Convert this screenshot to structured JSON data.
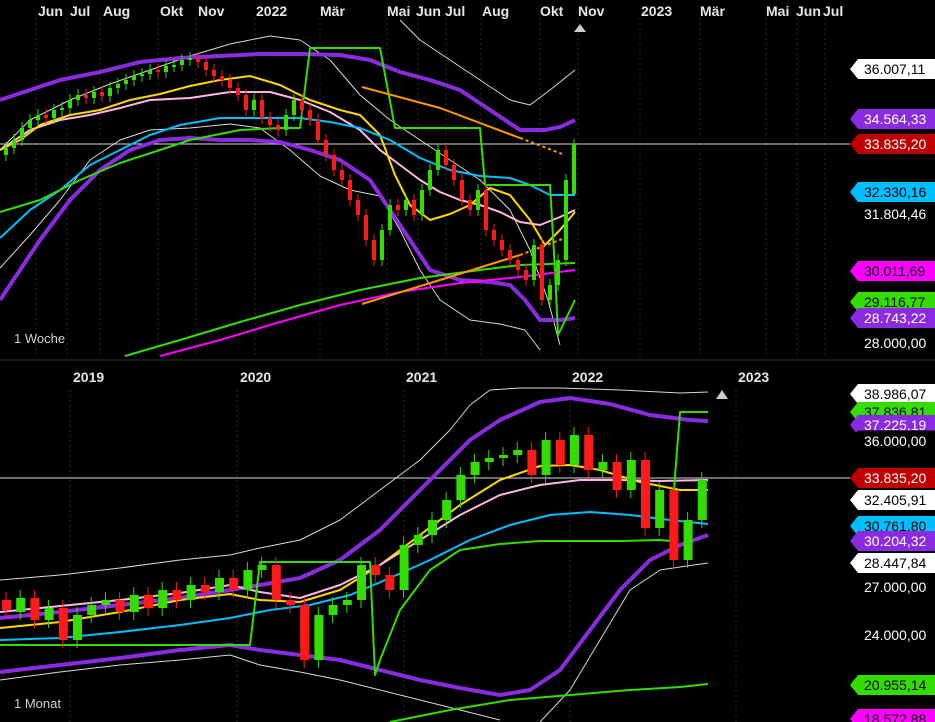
{
  "top_panel": {
    "period_label": "1 Woche",
    "time_labels": [
      "Jun",
      "Jul",
      "Aug",
      "Okt",
      "Nov",
      "2022",
      "Mär",
      "Mai",
      "Jun",
      "Jul",
      "Aug",
      "Okt",
      "Nov",
      "2023",
      "Mär",
      "Mai",
      "Jun",
      "Jul"
    ],
    "price_tags": [
      {
        "text": "36.007,11",
        "bg": "#ffffff",
        "fg": "#000000"
      },
      {
        "text": "34.564,33",
        "bg": "#8a2be2",
        "fg": "#ffffff"
      },
      {
        "text": "33.835,20",
        "bg": "#c00000",
        "fg": "#ffffff"
      },
      {
        "text": "32.330,16",
        "bg": "#00bfff",
        "fg": "#000000"
      },
      {
        "text": "31.804,46",
        "bg": "#000000",
        "fg": "#ffffff"
      },
      {
        "text": "30.011,69",
        "bg": "#ff00ff",
        "fg": "#000000"
      },
      {
        "text": "29.116,77",
        "bg": "#33dd00",
        "fg": "#000000"
      },
      {
        "text": "28.743,22",
        "bg": "#8a2be2",
        "fg": "#ffffff"
      },
      {
        "text": "28.000,00",
        "bg": "#000000",
        "fg": "#ffffff"
      }
    ]
  },
  "bottom_panel": {
    "period_label": "1 Monat",
    "time_labels": [
      "2019",
      "2020",
      "2021",
      "2022",
      "2023"
    ],
    "price_tags": [
      {
        "text": "38.986,07",
        "bg": "#ffffff",
        "fg": "#000000"
      },
      {
        "text": "37.836,81",
        "bg": "#33dd00",
        "fg": "#000000"
      },
      {
        "text": "37.225,19",
        "bg": "#8a2be2",
        "fg": "#ffffff"
      },
      {
        "text": "36.000,00",
        "bg": "#000000",
        "fg": "#ffffff"
      },
      {
        "text": "33.835,20",
        "bg": "#c00000",
        "fg": "#ffffff"
      },
      {
        "text": "32.405,91",
        "bg": "#ffffff",
        "fg": "#000000"
      },
      {
        "text": "30.761,80",
        "bg": "#00bfff",
        "fg": "#000000"
      },
      {
        "text": "30.204,32",
        "bg": "#8a2be2",
        "fg": "#ffffff"
      },
      {
        "text": "28.447,84",
        "bg": "#ffffff",
        "fg": "#000000"
      },
      {
        "text": "27.000,00",
        "bg": "#000000",
        "fg": "#ffffff"
      },
      {
        "text": "24.000,00",
        "bg": "#000000",
        "fg": "#ffffff"
      },
      {
        "text": "20.955,14",
        "bg": "#33dd00",
        "fg": "#000000"
      },
      {
        "text": "18.572,88",
        "bg": "#ff00ff",
        "fg": "#000000"
      }
    ]
  },
  "colors": {
    "up_candle": "#33dd00",
    "down_candle": "#ff1a1a",
    "bollinger": "#ffffff",
    "keltner": "#8a2be2",
    "ma_fast": "#ffd700",
    "ma_mid": "#ffb6e6",
    "ma_slow": "#00bfff",
    "ma_long": "#33dd00",
    "ma_longest": "#ff00ff",
    "trend": "#ff9900",
    "current": "#ffffff"
  },
  "chart_data": [
    {
      "type": "candlestick",
      "title": "",
      "timeframe": "1 Woche",
      "x_ticks": [
        "Jun",
        "Jul",
        "Aug",
        "Okt",
        "Nov",
        "2022",
        "Mär",
        "Mai",
        "Jun",
        "Jul",
        "Aug",
        "Okt",
        "Nov",
        "2023",
        "Mär",
        "Mai",
        "Jun",
        "Jul"
      ],
      "y_ticks": [
        28000
      ],
      "last_price": 33835.2,
      "indicator_values": {
        "bollinger_upper": 36007.11,
        "keltner_upper": 34564.33,
        "ma_slow": 32330.16,
        "bollinger_mid": 31804.46,
        "ma_longest": 30011.69,
        "ma_long": 29116.77,
        "keltner_lower": 28743.22
      }
    },
    {
      "type": "candlestick",
      "title": "",
      "timeframe": "1 Monat",
      "x_ticks": [
        "2019",
        "2020",
        "2021",
        "2022",
        "2023"
      ],
      "y_ticks": [
        24000,
        27000,
        36000
      ],
      "last_price": 33835.2,
      "indicator_values": {
        "bollinger_upper": 38986.07,
        "ma_long_shift": 37836.81,
        "keltner_upper": 37225.19,
        "ma_fast": 32405.91,
        "ma_slow": 30761.8,
        "keltner_lower": 30204.32,
        "bollinger_lower": 28447.84,
        "ma_long": 20955.14,
        "ma_longest": 18572.88
      }
    }
  ]
}
